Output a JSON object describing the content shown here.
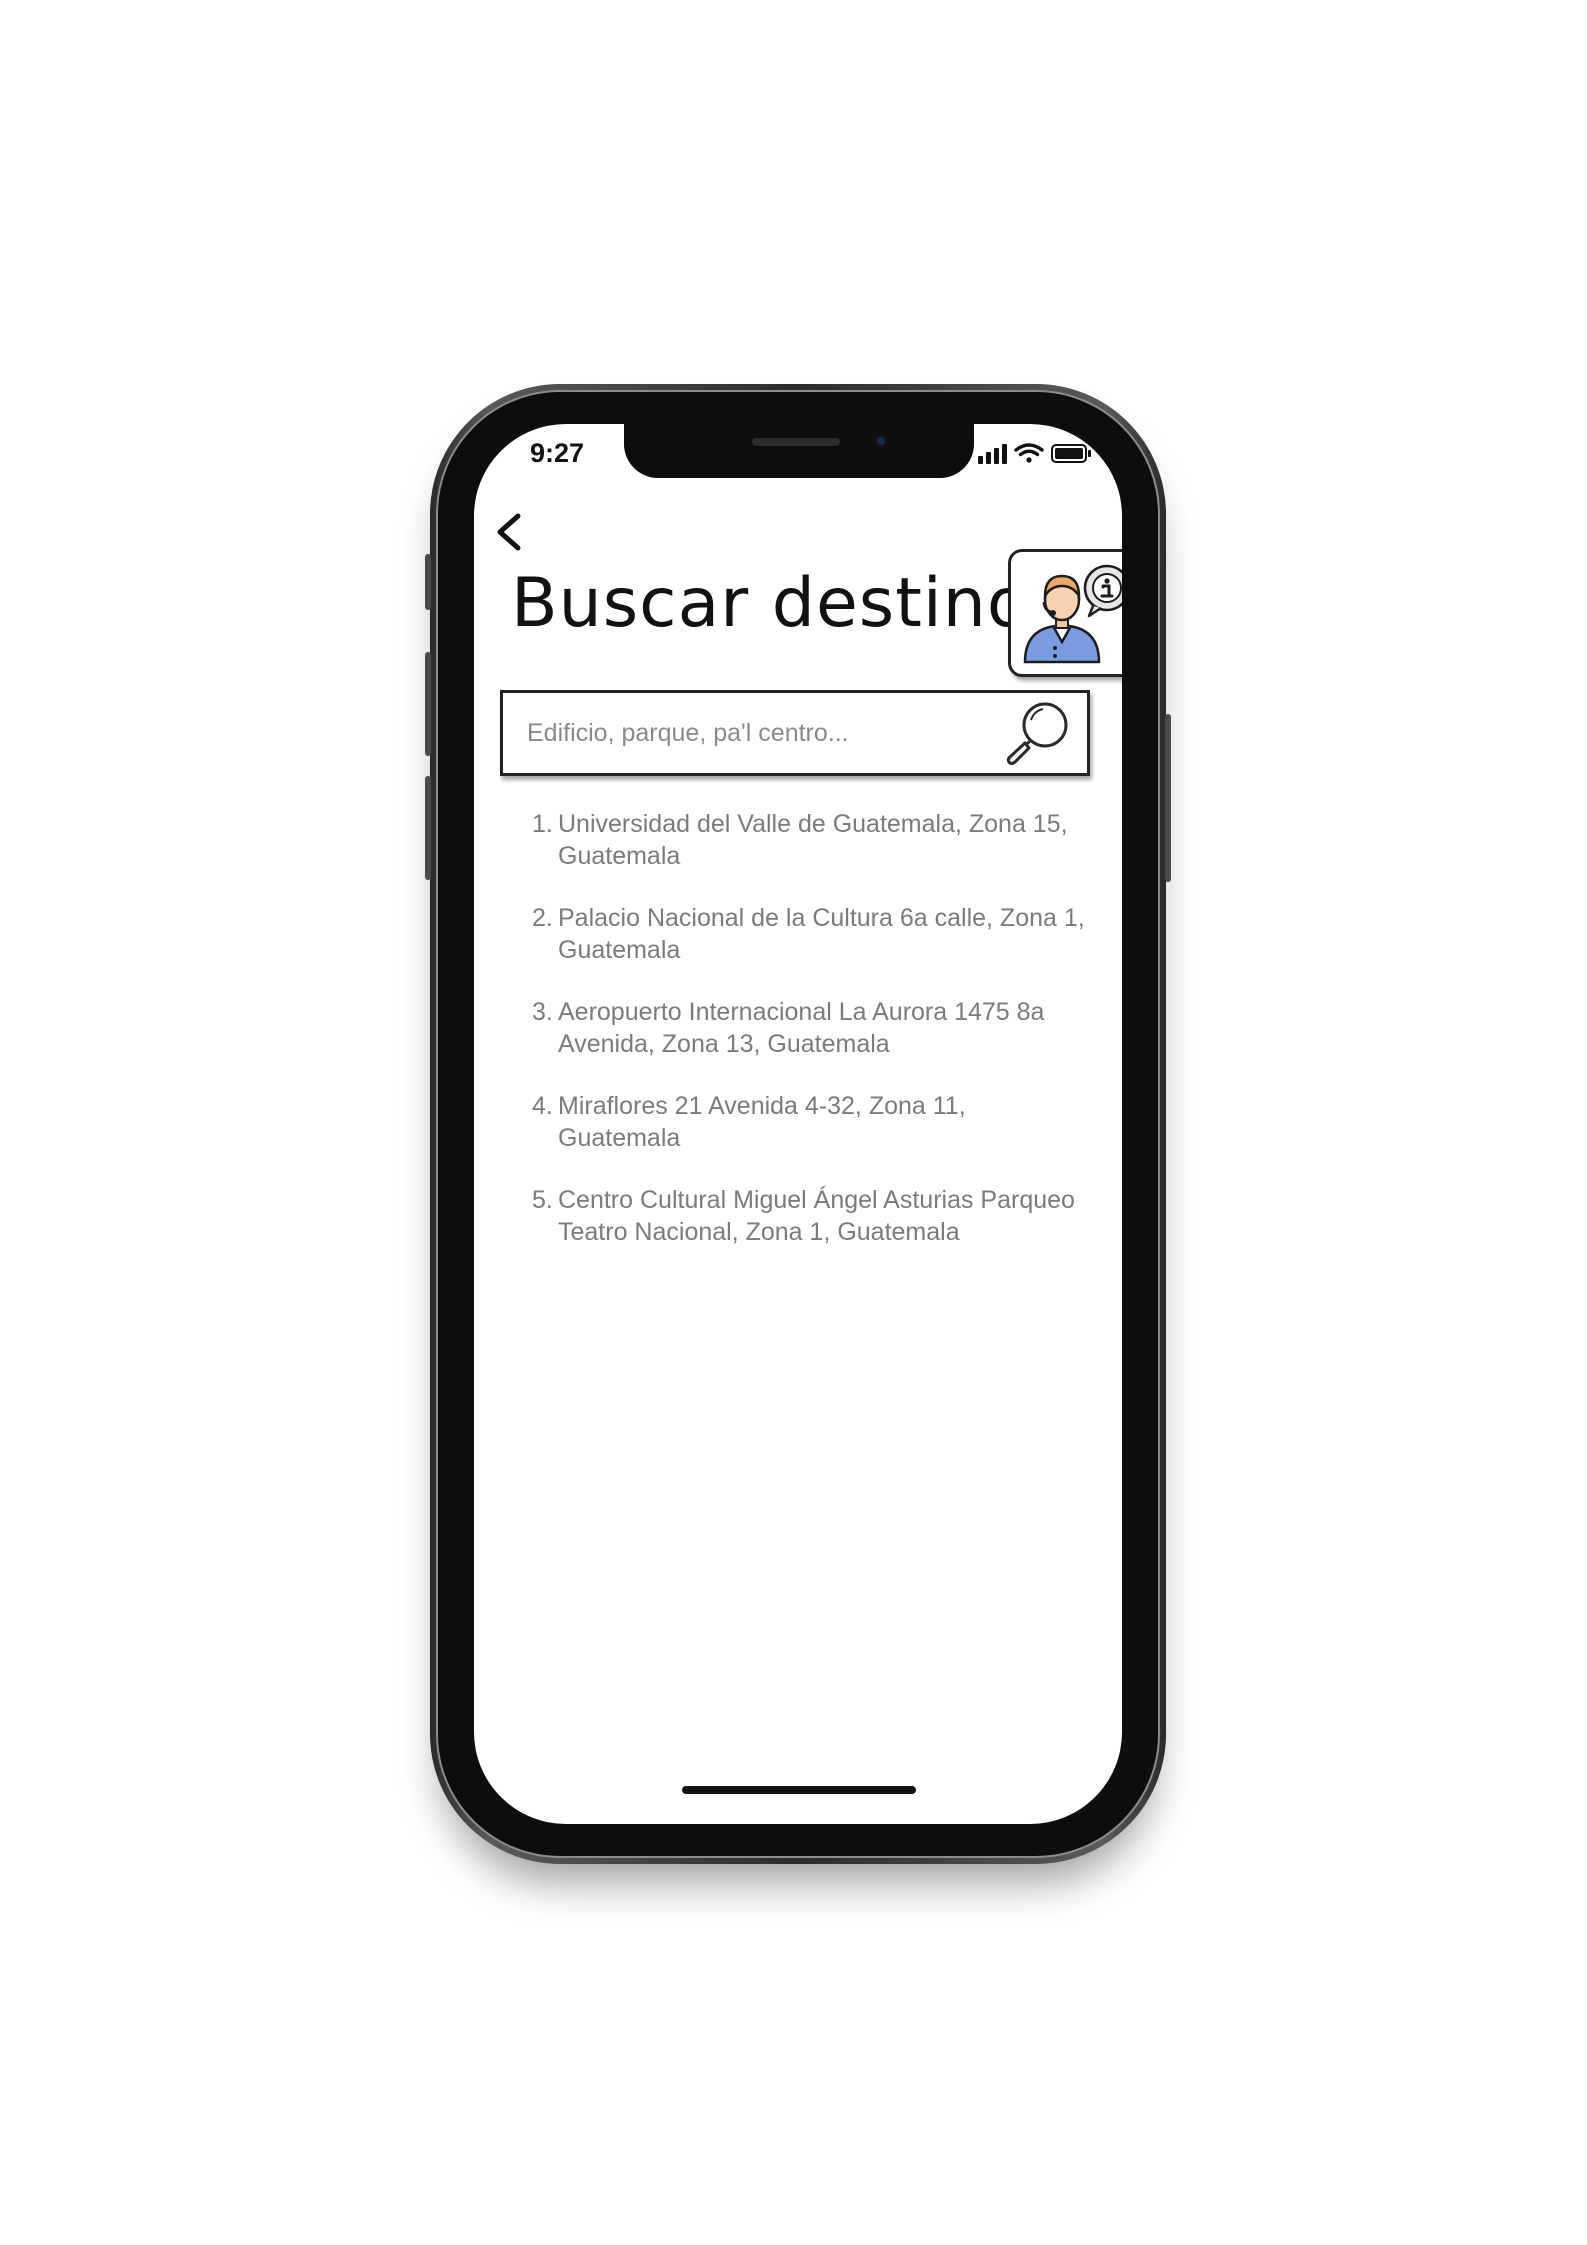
{
  "status_bar": {
    "time": "9:27"
  },
  "header": {
    "back_icon": "chevron-left-icon",
    "title": "Buscar destino",
    "help_icon": "assistant-info-icon"
  },
  "search": {
    "placeholder": "Edificio, parque, pa'l centro...",
    "value": "",
    "icon": "magnifier-icon"
  },
  "results": [
    {
      "number": "1.",
      "text": "Universidad del Valle de Guatemala, Zona 15, Guatemala"
    },
    {
      "number": "2.",
      "text": "Palacio Nacional de la Cultura 6a calle,  Zona 1, Guatemala"
    },
    {
      "number": "3.",
      "text": "Aeropuerto Internacional La  Aurora  1475  8a Avenida, Zona 13, Guatemala"
    },
    {
      "number": "4.",
      "text": "Miraflores 21 Avenida 4-32, Zona 11, Guatemala"
    },
    {
      "number": "5.",
      "text": "Centro Cultural Miguel Ángel Asturias Parqueo Teatro Nacional, Zona 1, Guatemala"
    }
  ],
  "colors": {
    "title": "#111111",
    "result_text": "#7b7b7b",
    "placeholder": "#8a8a8a",
    "assistant_shirt": "#7a9be0"
  }
}
